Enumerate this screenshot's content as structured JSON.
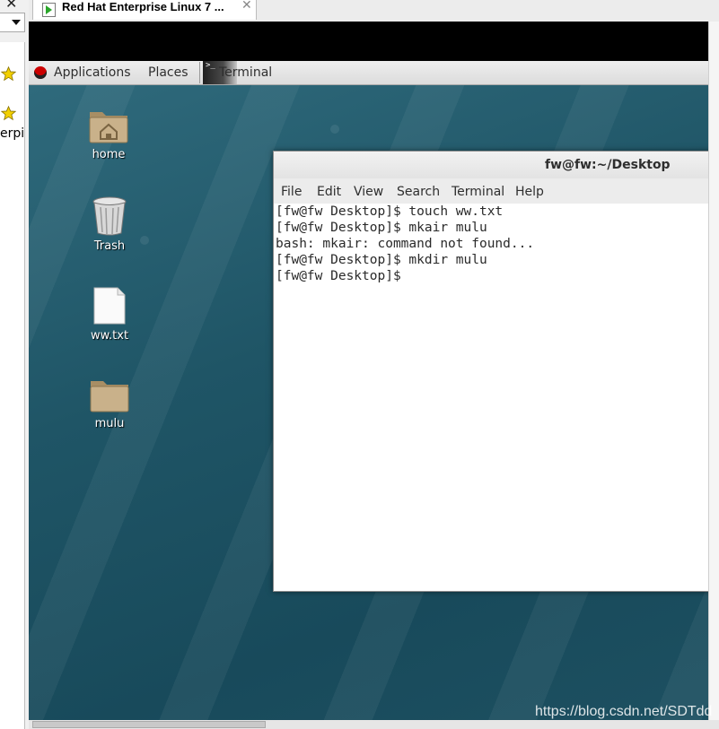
{
  "host": {
    "tab_title": "Red Hat Enterprise Linux 7 ...",
    "tab_close_glyph": "✕",
    "window_close_glyph": "✕",
    "side_partial_text": "erpi",
    "icons": [
      "star-icon",
      "star-icon"
    ]
  },
  "gnome_panel": {
    "applications": "Applications",
    "places": "Places",
    "taskbar_terminal": "Terminal"
  },
  "desktop": {
    "icons": [
      {
        "label": "home",
        "icon": "home-folder-icon"
      },
      {
        "label": "Trash",
        "icon": "trash-icon"
      },
      {
        "label": "ww.txt",
        "icon": "text-file-icon"
      },
      {
        "label": "mulu",
        "icon": "folder-icon"
      }
    ]
  },
  "terminal": {
    "title": "fw@fw:~/Desktop",
    "menu": [
      "File",
      "Edit",
      "View",
      "Search",
      "Terminal",
      "Help"
    ],
    "lines": [
      "[fw@fw Desktop]$ touch ww.txt",
      "[fw@fw Desktop]$ mkair mulu",
      "bash: mkair: command not found...",
      "[fw@fw Desktop]$ mkdir mulu",
      "[fw@fw Desktop]$"
    ]
  },
  "watermark": "https://blog.csdn.net/SDTdd",
  "colors": {
    "desktop": "#1f5566",
    "panel": "#e6e6e6",
    "tab_icon_play": "#2aa62a",
    "redhat": "#cc0000"
  }
}
